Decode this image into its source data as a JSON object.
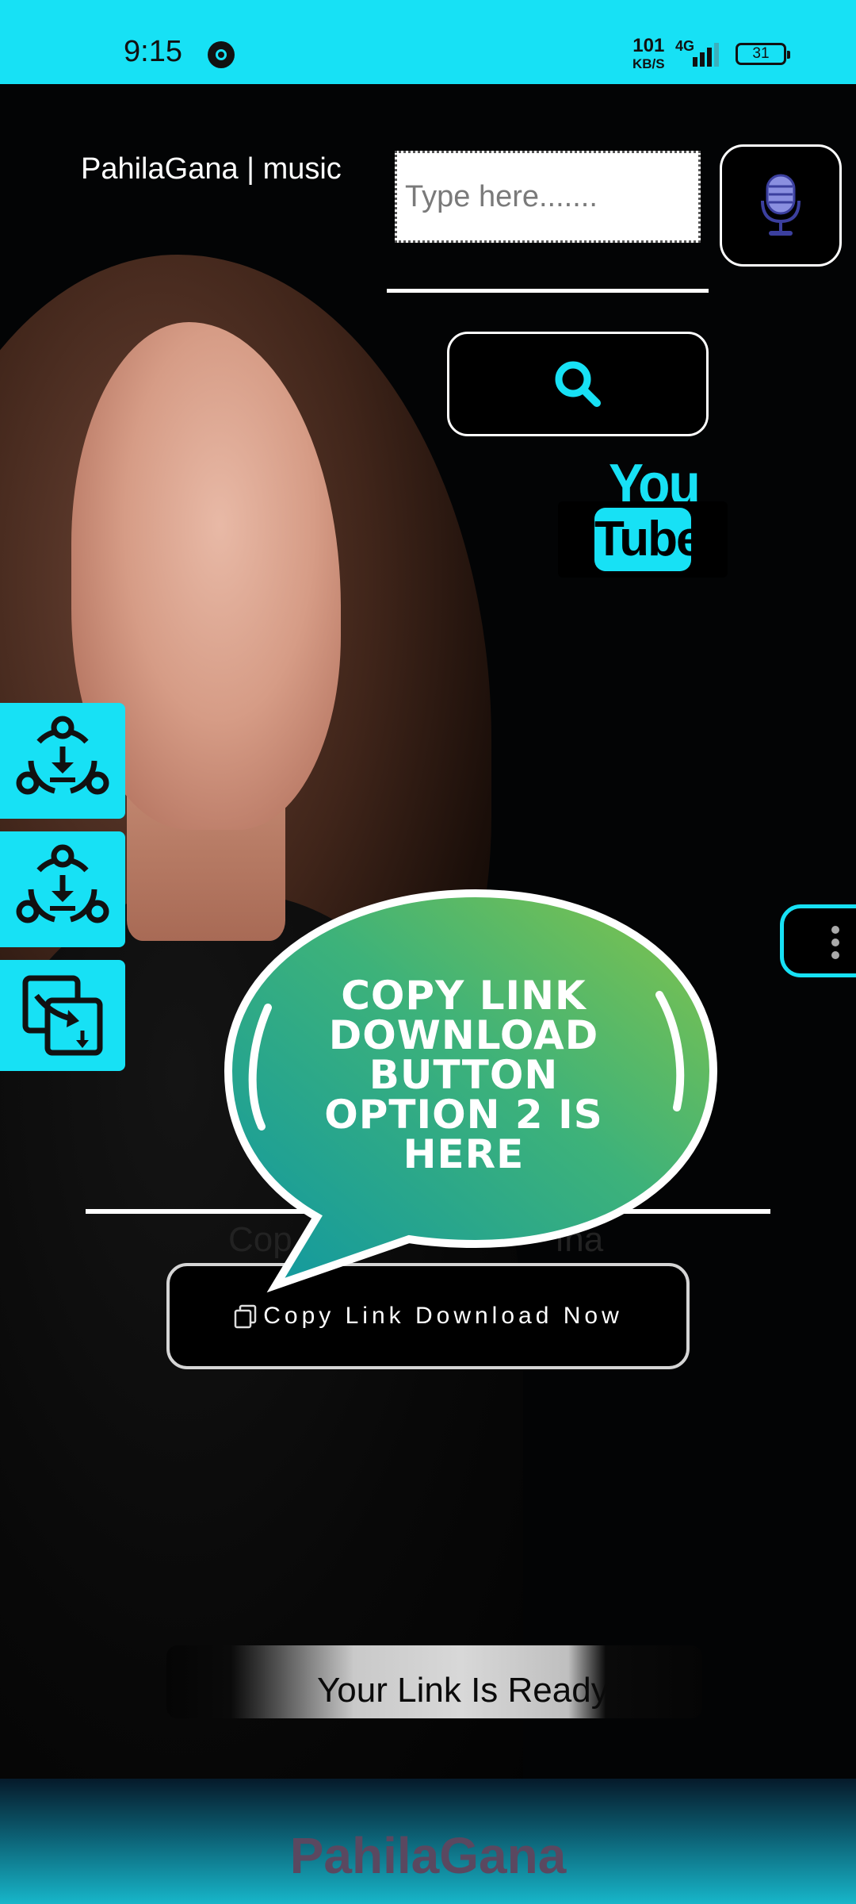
{
  "status_bar": {
    "time": "9:15",
    "net_speed": "101",
    "net_unit": "KB/S",
    "network": "4G",
    "battery": "31"
  },
  "header": {
    "title": "PahilaGana | music"
  },
  "search": {
    "placeholder": "Type here......."
  },
  "youtube_logo": {
    "you": "You",
    "tube": "Tube"
  },
  "bubble": {
    "lines": [
      "COPY LINK",
      "DOWNLOAD",
      "BUTTON",
      "OPTION 2 IS",
      "HERE"
    ]
  },
  "copy_section": {
    "faded_left": "Cop",
    "faded_right": "ına",
    "button_label": "Copy Link Download Now"
  },
  "ready": {
    "text": "Your Link Is Ready"
  },
  "footer": {
    "brand": "PahilaGana"
  },
  "colors": {
    "accent": "#17e1f5",
    "bubble_start": "#1aa0a0",
    "bubble_end": "#7cc24a"
  },
  "icons": [
    "chrome-icon",
    "signal-icon",
    "battery-icon",
    "microphone-icon",
    "search-icon",
    "download-share-icon",
    "download-share-icon",
    "copy-move-icon",
    "more-vertical-icon",
    "copy-icon"
  ]
}
